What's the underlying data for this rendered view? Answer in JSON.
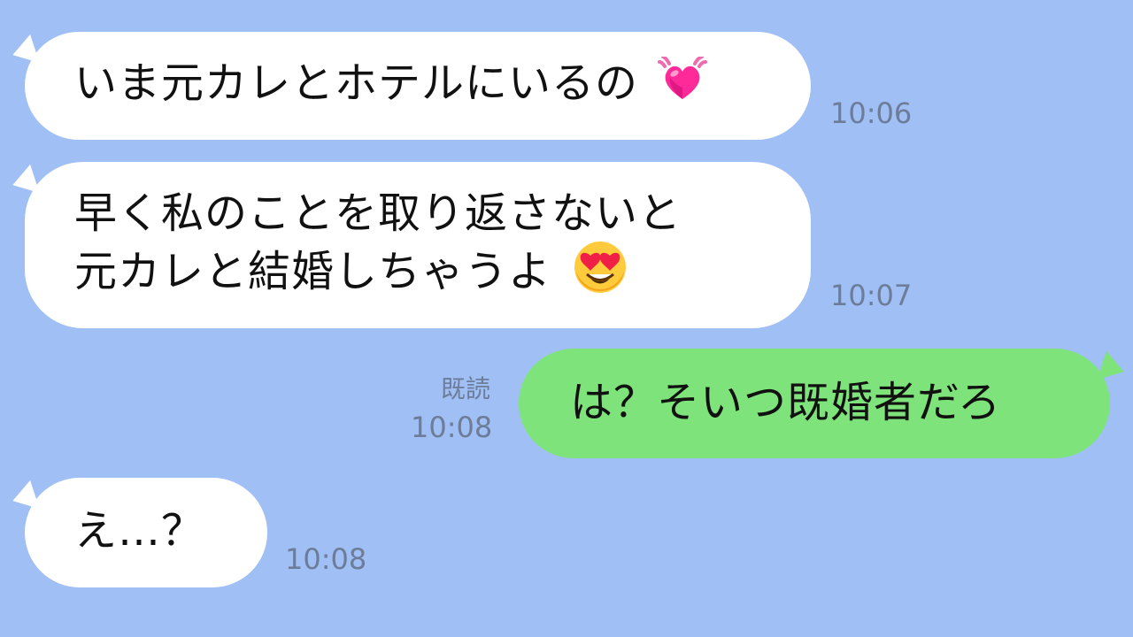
{
  "chat": {
    "messages": [
      {
        "id": "msg1",
        "direction": "incoming",
        "text": "いま元カレとホテルにいるの",
        "emoji": "heart-icon",
        "time": "10:06"
      },
      {
        "id": "msg2",
        "direction": "incoming",
        "lines": [
          "早く私のことを取り返さないと",
          "元カレと結婚しちゃうよ"
        ],
        "emoji": "heart-eyes-smiley-icon",
        "time": "10:07"
      },
      {
        "id": "msg3",
        "direction": "outgoing",
        "text": "は？そいつ既婚者だろ",
        "read_label": "既読",
        "time": "10:08"
      },
      {
        "id": "msg4",
        "direction": "incoming",
        "text": "え…？",
        "time": "10:08"
      }
    ],
    "colors": {
      "background": "#9fbff5",
      "incoming_bubble": "#ffffff",
      "outgoing_bubble": "#7ee37a",
      "meta_text": "#6d7d99"
    }
  }
}
